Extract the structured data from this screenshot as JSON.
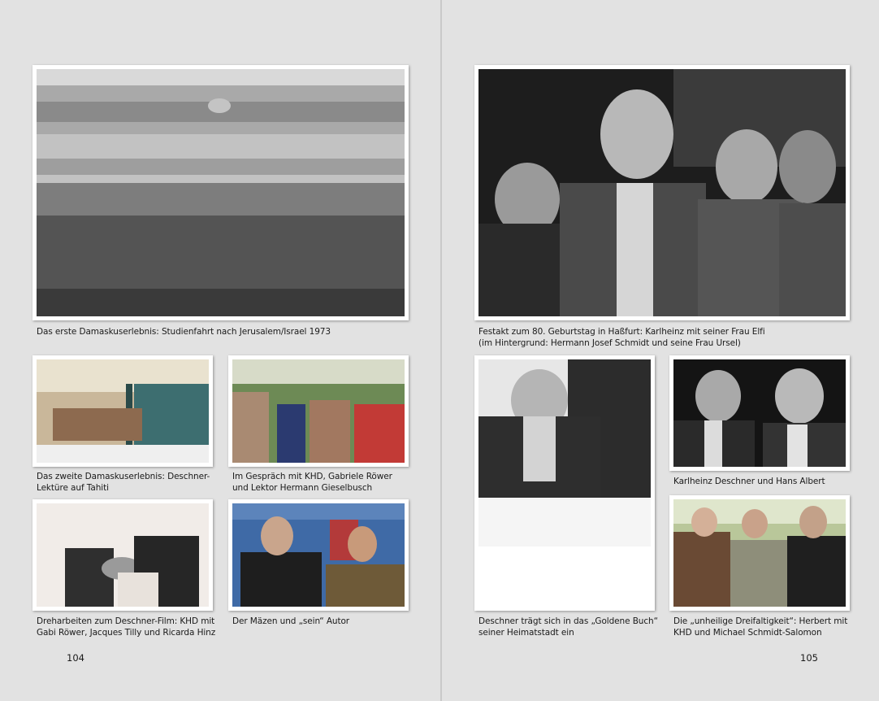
{
  "left_page": {
    "page_number": "104",
    "captions": {
      "jerusalem": [
        "Das erste Damaskuserlebnis: Studienfahrt nach Jerusalem/Israel 1973"
      ],
      "tahiti": [
        "Das zweite Damaskuserlebnis: Deschner-",
        "Lektüre auf Tahiti"
      ],
      "gespraech": [
        "Im Gespräch mit KHD, Gabriele Röwer",
        "und Lektor Hermann Gieselbusch"
      ],
      "dreharbeiten": [
        "Dreharbeiten zum Deschner-Film: KHD mit",
        "Gabi Röwer, Jacques Tilly und Ricarda Hinz"
      ],
      "maezen": [
        "Der Mäzen und „sein“ Autor"
      ]
    }
  },
  "right_page": {
    "page_number": "105",
    "captions": {
      "festakt": [
        "Festakt zum 80. Geburtstag in Haßfurt: Karlheinz mit seiner Frau Elfi",
        "(im Hintergrund: Hermann Josef Schmidt und seine Frau Ursel)"
      ],
      "goldenes_buch": [
        "Deschner trägt sich in das „Goldene Buch“",
        "seiner Heimatstadt ein"
      ],
      "albert": [
        "Karlheinz Deschner und Hans Albert"
      ],
      "dreifaltigkeit": [
        "Die „unheilige Dreifaltigkeit“: Herbert mit",
        "KHD und Michael Schmidt-Salomon"
      ]
    }
  }
}
